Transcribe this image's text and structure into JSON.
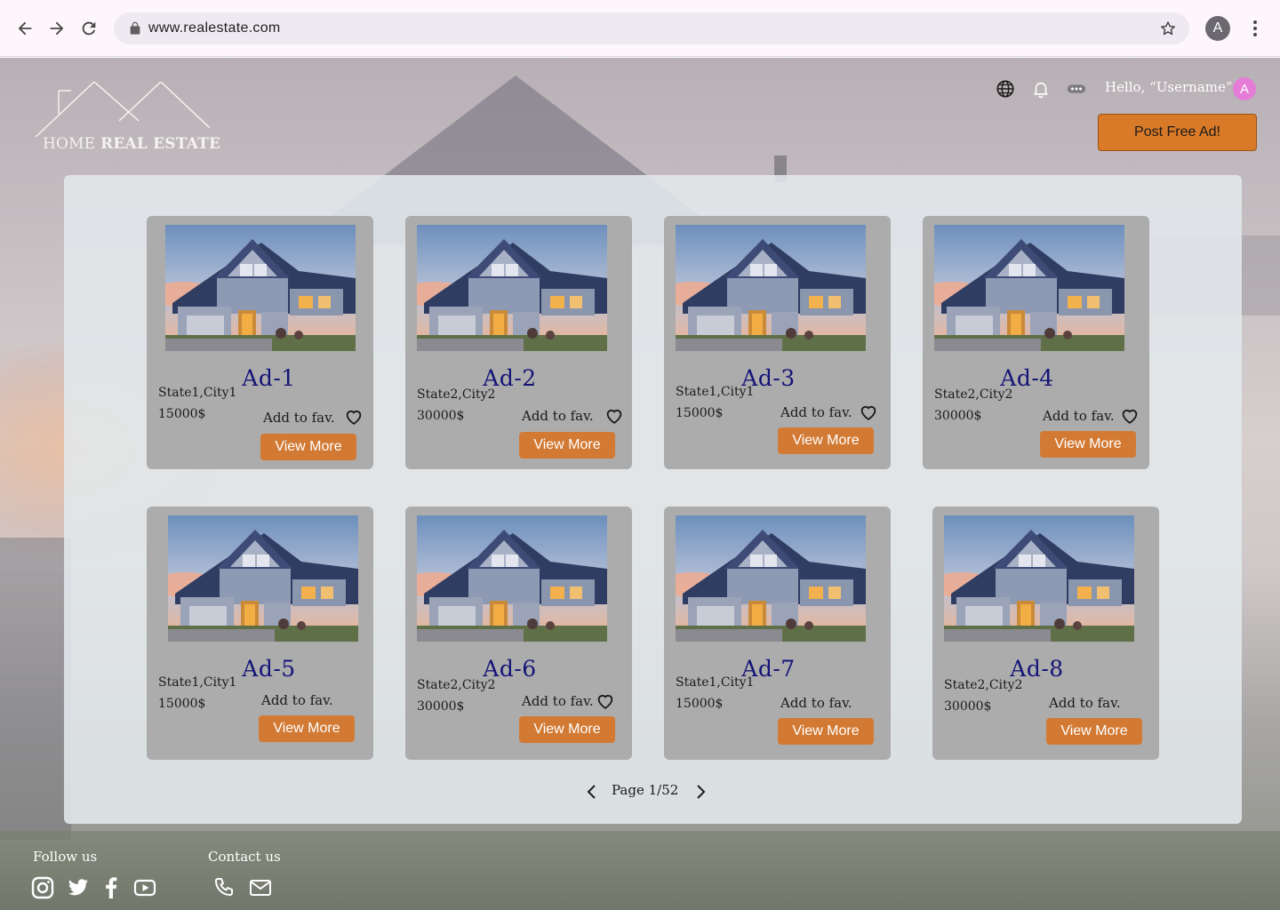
{
  "browser": {
    "url": "www.realestate.com",
    "profile_initial": "A",
    "icons": [
      "back-arrow-icon",
      "forward-arrow-icon",
      "reload-icon",
      "lock-icon",
      "star-icon",
      "more-vert-icon"
    ]
  },
  "header": {
    "logo_light": "HOME",
    "logo_bold": "REAL ESTATE",
    "greeting": "Hello, “Username”",
    "avatar_initial": "A",
    "post_button": "Post Free Ad!",
    "icons": [
      "globe-icon",
      "bell-icon",
      "more-horiz-icon"
    ]
  },
  "listings": [
    {
      "title": "Ad-1",
      "location": "State1,City1",
      "price": "15000$",
      "fav_label": "Add to fav.",
      "button": "View More",
      "heart": true
    },
    {
      "title": "Ad-2",
      "location": "State2,City2",
      "price": "30000$",
      "fav_label": "Add to fav.",
      "button": "View More",
      "heart": true
    },
    {
      "title": "Ad-3",
      "location": "State1,City1",
      "price": "15000$",
      "fav_label": "Add to fav.",
      "button": "View More",
      "heart": true
    },
    {
      "title": "Ad-4",
      "location": "State2,City2",
      "price": "30000$",
      "fav_label": "Add to fav.",
      "button": "View More",
      "heart": true
    },
    {
      "title": "Ad-5",
      "location": "State1,City1",
      "price": "15000$",
      "fav_label": "Add to fav.",
      "button": "View More",
      "heart": false
    },
    {
      "title": "Ad-6",
      "location": "State2,City2",
      "price": "30000$",
      "fav_label": "Add to fav.",
      "button": "View More",
      "heart": true
    },
    {
      "title": "Ad-7",
      "location": "State1,City1",
      "price": "15000$",
      "fav_label": "Add to fav.",
      "button": "View More",
      "heart": false
    },
    {
      "title": "Ad-8",
      "location": "State2,City2",
      "price": "30000$",
      "fav_label": "Add to fav.",
      "button": "View More",
      "heart": false
    }
  ],
  "pagination": {
    "label": "Page 1/52",
    "current": 1,
    "total": 52
  },
  "footer": {
    "follow_label": "Follow us",
    "contact_label": "Contact us",
    "social_icons": [
      "instagram-icon",
      "twitter-icon",
      "facebook-icon",
      "youtube-icon"
    ],
    "contact_icons": [
      "phone-icon",
      "mail-icon"
    ]
  },
  "colors": {
    "accent_orange": "#d27a34",
    "title_navy": "#141478",
    "card_gray": "#acacac",
    "avatar_pink": "#e47cd8"
  }
}
